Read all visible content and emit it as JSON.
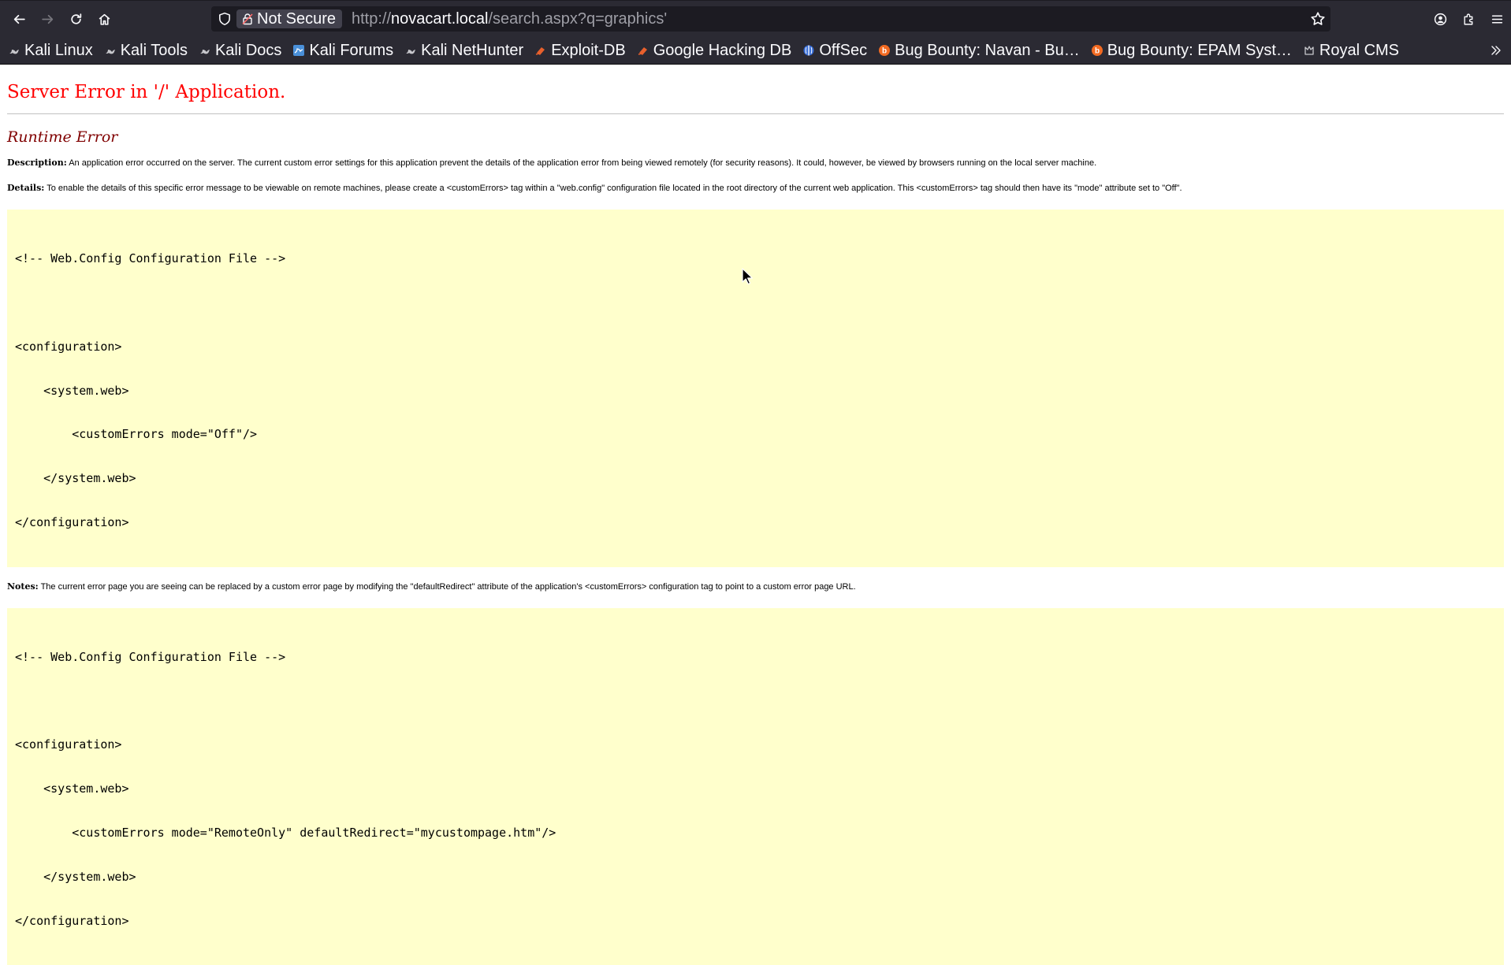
{
  "browser": {
    "nav": {
      "back_icon": "arrow-left-icon",
      "forward_icon": "arrow-right-icon",
      "reload_icon": "reload-icon",
      "home_icon": "home-icon"
    },
    "urlbar": {
      "security_label": "Not Secure",
      "url_scheme": "http://",
      "url_host": "novacart.local",
      "url_path": "/search.aspx?q=graphics'"
    },
    "bookmarks": [
      {
        "label": "Kali Linux",
        "icon": "kali-dragon-icon"
      },
      {
        "label": "Kali Tools",
        "icon": "kali-dragon-icon"
      },
      {
        "label": "Kali Docs",
        "icon": "kali-dragon-icon"
      },
      {
        "label": "Kali Forums",
        "icon": "kali-forums-icon"
      },
      {
        "label": "Kali NetHunter",
        "icon": "kali-dragon-icon"
      },
      {
        "label": "Exploit-DB",
        "icon": "exploitdb-icon"
      },
      {
        "label": "Google Hacking DB",
        "icon": "ghdb-icon"
      },
      {
        "label": "OffSec",
        "icon": "offsec-icon"
      },
      {
        "label": "Bug Bounty: Navan - Bu…",
        "icon": "bugbounty-icon"
      },
      {
        "label": "Bug Bounty: EPAM Syst…",
        "icon": "bugbounty-icon"
      },
      {
        "label": "Royal CMS",
        "icon": "royal-cms-icon"
      }
    ],
    "colors": {
      "chrome": "#2b2a33",
      "urlbar": "#1c1b22",
      "text": "#fbfbfe"
    }
  },
  "page": {
    "title": "Server Error in '/' Application.",
    "subtitle": "Runtime Error",
    "description_label": "Description:",
    "description_text": " An application error occurred on the server. The current custom error settings for this application prevent the details of the application error from being viewed remotely (for security reasons). It could, however, be viewed by browsers running on the local server machine.",
    "details_label": "Details:",
    "details_text": " To enable the details of this specific error message to be viewable on remote machines, please create a <customErrors> tag within a \"web.config\" configuration file located in the root directory of the current web application. This <customErrors> tag should then have its \"mode\" attribute set to \"Off\".",
    "code1": [
      "<!-- Web.Config Configuration File -->",
      "",
      "<configuration>",
      "    <system.web>",
      "        <customErrors mode=\"Off\"/>",
      "    </system.web>",
      "</configuration>"
    ],
    "notes_label": "Notes:",
    "notes_text": " The current error page you are seeing can be replaced by a custom error page by modifying the \"defaultRedirect\" attribute of the application's <customErrors> configuration tag to point to a custom error page URL.",
    "code2": [
      "<!-- Web.Config Configuration File -->",
      "",
      "<configuration>",
      "    <system.web>",
      "        <customErrors mode=\"RemoteOnly\" defaultRedirect=\"mycustompage.htm\"/>",
      "    </system.web>",
      "</configuration>"
    ],
    "colors": {
      "title": "#ff0000",
      "subtitle": "#800000",
      "code_bg": "#ffffcc"
    }
  }
}
